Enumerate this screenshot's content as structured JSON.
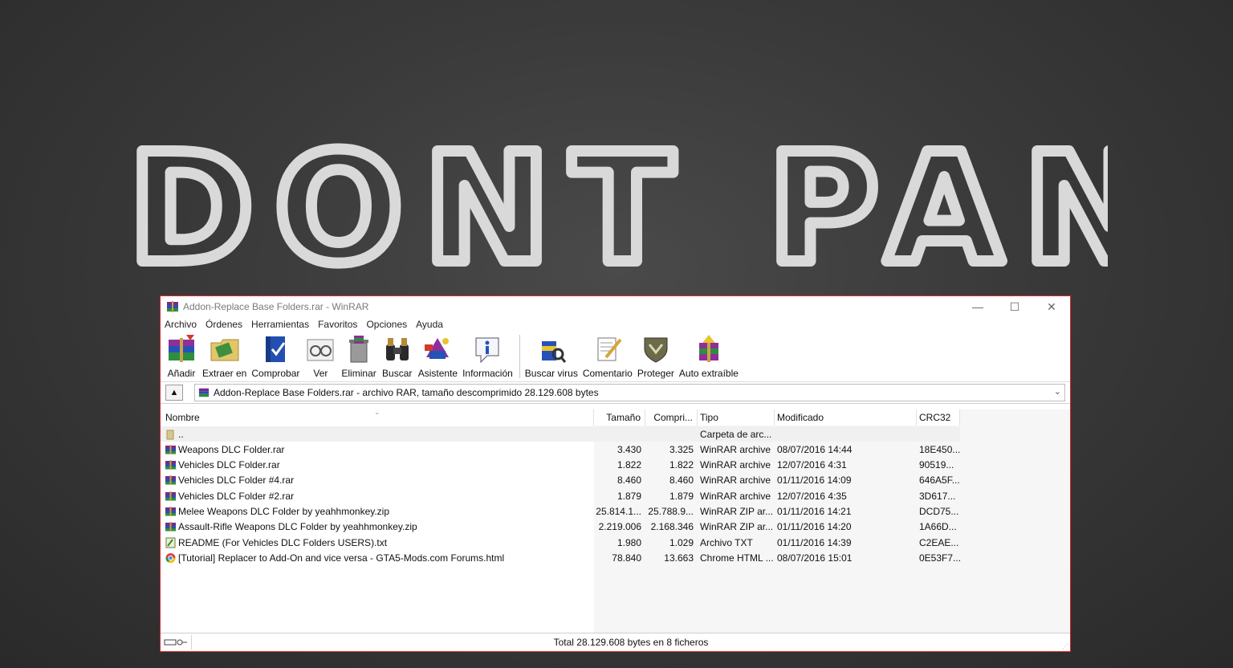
{
  "background": {
    "headline": "DONT PANIC"
  },
  "window": {
    "title": "Addon-Replace Base Folders.rar - WinRAR",
    "controls": {
      "minimize": "—",
      "maximize": "☐",
      "close": "✕"
    }
  },
  "menu": [
    "Archivo",
    "Órdenes",
    "Herramientas",
    "Favoritos",
    "Opciones",
    "Ayuda"
  ],
  "toolbar": {
    "add": "Añadir",
    "extract": "Extraer en",
    "test": "Comprobar",
    "view": "Ver",
    "delete": "Eliminar",
    "find": "Buscar",
    "wizard": "Asistente",
    "info": "Información",
    "virus": "Buscar virus",
    "comment": "Comentario",
    "protect": "Proteger",
    "sfx": "Auto extraíble"
  },
  "address": {
    "path": "Addon-Replace Base Folders.rar - archivo RAR, tamaño descomprimido 28.129.608 bytes"
  },
  "columns": {
    "name": "Nombre",
    "size": "Tamaño",
    "packed": "Compri...",
    "type": "Tipo",
    "modified": "Modificado",
    "crc": "CRC32"
  },
  "files": [
    {
      "name": "..",
      "size": "",
      "packed": "",
      "type": "Carpeta de arc...",
      "modified": "",
      "crc": "",
      "icon": "folder-icon"
    },
    {
      "name": "Weapons DLC Folder.rar",
      "size": "3.430",
      "packed": "3.325",
      "type": "WinRAR archive",
      "modified": "08/07/2016 14:44",
      "crc": "18E450...",
      "icon": "rar-icon"
    },
    {
      "name": "Vehicles DLC Folder.rar",
      "size": "1.822",
      "packed": "1.822",
      "type": "WinRAR archive",
      "modified": "12/07/2016 4:31",
      "crc": "90519...",
      "icon": "rar-icon"
    },
    {
      "name": "Vehicles DLC Folder #4.rar",
      "size": "8.460",
      "packed": "8.460",
      "type": "WinRAR archive",
      "modified": "01/11/2016 14:09",
      "crc": "646A5F...",
      "icon": "rar-icon"
    },
    {
      "name": "Vehicles DLC Folder #2.rar",
      "size": "1.879",
      "packed": "1.879",
      "type": "WinRAR archive",
      "modified": "12/07/2016 4:35",
      "crc": "3D617...",
      "icon": "rar-icon"
    },
    {
      "name": "Melee Weapons DLC Folder by yeahhmonkey.zip",
      "size": "25.814.1...",
      "packed": "25.788.9...",
      "type": "WinRAR ZIP ar...",
      "modified": "01/11/2016 14:21",
      "crc": "DCD75...",
      "icon": "zip-icon"
    },
    {
      "name": "Assault-Rifle Weapons DLC Folder by yeahhmonkey.zip",
      "size": "2.219.006",
      "packed": "2.168.346",
      "type": "WinRAR ZIP ar...",
      "modified": "01/11/2016 14:20",
      "crc": "1A66D...",
      "icon": "zip-icon"
    },
    {
      "name": "README (For Vehicles DLC Folders USERS).txt",
      "size": "1.980",
      "packed": "1.029",
      "type": "Archivo TXT",
      "modified": "01/11/2016 14:39",
      "crc": "C2EAE...",
      "icon": "txt-icon"
    },
    {
      "name": "[Tutorial] Replacer to Add-On and vice versa - GTA5-Mods.com Forums.html",
      "size": "78.840",
      "packed": "13.663",
      "type": "Chrome HTML ...",
      "modified": "08/07/2016 15:01",
      "crc": "0E53F7...",
      "icon": "chrome-icon"
    }
  ],
  "status": {
    "text": "Total 28.129.608 bytes en 8 ficheros"
  },
  "colors": {
    "window_border": "#e2252a",
    "chalk": "#d9d9d9"
  }
}
